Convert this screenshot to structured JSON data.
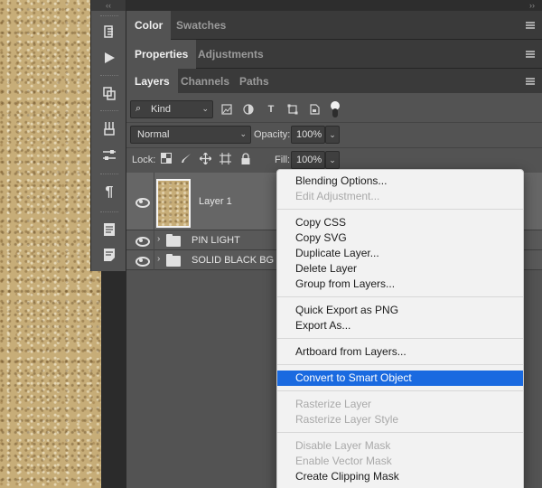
{
  "panels": {
    "color_tab": "Color",
    "swatches_tab": "Swatches",
    "properties_tab": "Properties",
    "adjustments_tab": "Adjustments",
    "layers_tab": "Layers",
    "channels_tab": "Channels",
    "paths_tab": "Paths",
    "collapse_left": "‹‹",
    "collapse_right": "››"
  },
  "filter": {
    "kind_label": "Kind"
  },
  "blending": {
    "mode": "Normal",
    "opacity_label": "Opacity:",
    "opacity_value": "100%",
    "lock_label": "Lock:",
    "fill_label": "Fill:",
    "fill_value": "100%"
  },
  "layers": [
    {
      "name": "Layer 1"
    },
    {
      "name": "PIN LIGHT"
    },
    {
      "name": "SOLID BLACK BG"
    }
  ],
  "context_menu": {
    "items": [
      {
        "label": "Blending Options...",
        "enabled": true
      },
      {
        "label": "Edit Adjustment...",
        "enabled": false
      },
      {
        "label": "Copy CSS",
        "enabled": true
      },
      {
        "label": "Copy SVG",
        "enabled": true
      },
      {
        "label": "Duplicate Layer...",
        "enabled": true
      },
      {
        "label": "Delete Layer",
        "enabled": true
      },
      {
        "label": "Group from Layers...",
        "enabled": true
      },
      {
        "label": "Quick Export as PNG",
        "enabled": true
      },
      {
        "label": "Export As...",
        "enabled": true
      },
      {
        "label": "Artboard from Layers...",
        "enabled": true
      },
      {
        "label": "Convert to Smart Object",
        "enabled": true,
        "highlighted": true
      },
      {
        "label": "Rasterize Layer",
        "enabled": false
      },
      {
        "label": "Rasterize Layer Style",
        "enabled": false
      },
      {
        "label": "Disable Layer Mask",
        "enabled": false
      },
      {
        "label": "Enable Vector Mask",
        "enabled": false
      },
      {
        "label": "Create Clipping Mask",
        "enabled": true
      }
    ]
  },
  "colors": {
    "highlight": "#1a6ae0",
    "panel_bg": "#535353",
    "canvas": "#c7ad78"
  }
}
